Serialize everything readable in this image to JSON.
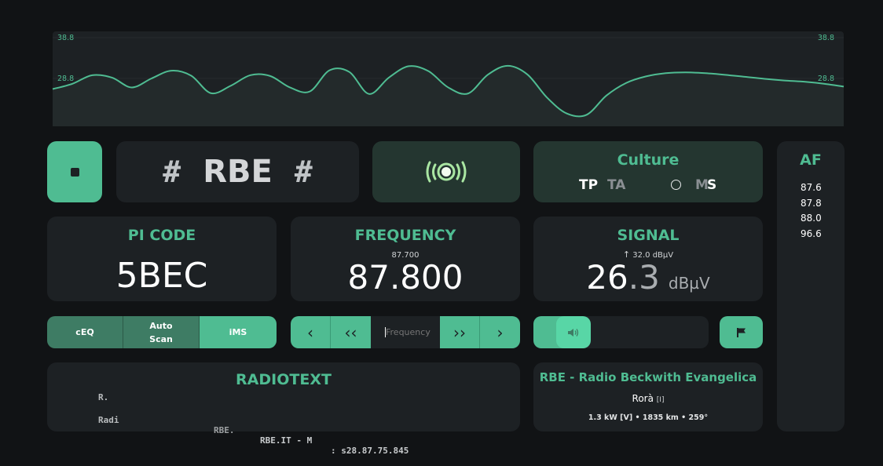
{
  "colors": {
    "accent": "#4fbc92",
    "panel": "#1d2124",
    "panel_dark": "#243630",
    "background": "#111315",
    "indicator_green": "#a9e6a2"
  },
  "chart_data": {
    "type": "area",
    "title": "",
    "xlabel": "",
    "ylabel": "",
    "ylim": [
      18.8,
      38.8
    ],
    "yticks": [
      "38.8",
      "28.8",
      "18.8"
    ],
    "grid": true,
    "x": [
      0,
      1,
      2,
      3,
      4,
      5,
      6,
      7,
      8,
      9,
      10,
      11,
      12,
      13,
      14,
      15,
      16,
      17,
      18,
      19,
      20,
      21,
      22,
      23,
      24,
      25,
      26,
      27,
      28,
      29,
      30,
      31,
      32,
      33,
      34,
      35,
      36,
      37,
      38,
      39,
      40
    ],
    "values": [
      26.2,
      27.5,
      29.6,
      29.0,
      26.6,
      28.8,
      30.7,
      29.5,
      25.2,
      27.0,
      29.6,
      29.4,
      26.6,
      25.6,
      30.8,
      30.4,
      25.0,
      29.0,
      31.8,
      30.6,
      26.6,
      25.1,
      29.7,
      31.9,
      29.8,
      24.1,
      20.2,
      19.9,
      24.6,
      27.7,
      29.3,
      30.1,
      30.3,
      30.1,
      29.7,
      29.2,
      28.7,
      28.3,
      28.0,
      27.5,
      26.8
    ]
  },
  "station": {
    "ps_left": "#",
    "ps_main": "RBE",
    "ps_right": "#",
    "pty": "Culture",
    "tp": "TP",
    "ta": "TA",
    "m": "M",
    "s": "S"
  },
  "af": {
    "title": "AF",
    "items": [
      "87.6",
      "87.8",
      "88.0",
      "96.6"
    ]
  },
  "pi": {
    "title": "PI CODE",
    "value": "5BEC"
  },
  "frequency": {
    "title": "FREQUENCY",
    "previous": "87.700",
    "value": "87.800"
  },
  "signal": {
    "title": "SIGNAL",
    "peak": "32.0 dBµV",
    "value_int": "26",
    "value_dec": ".3",
    "unit": "dBµV"
  },
  "controls": {
    "ceq": "cEQ",
    "auto_scan_line1": "Auto",
    "auto_scan_line2": "Scan",
    "ims": "iMS",
    "freq_placeholder": "Frequency",
    "prev": "‹",
    "prev_fast": "‹‹",
    "next_fast": "››",
    "next": "›",
    "volume_level": 0.12
  },
  "radiotext": {
    "title": "RADIOTEXT",
    "line1": "R.",
    "line2_a": "Radi",
    "line2_b": "RBE.",
    "line2_c": "RBE.IT - M",
    "line2_d": ": s28.87.75.845"
  },
  "tx": {
    "name": "RBE - Radio Beckwith Evangelica",
    "city": "Rorà",
    "country": "[I]",
    "details": "1.3 kW [V] • 1835 km • 259°"
  }
}
